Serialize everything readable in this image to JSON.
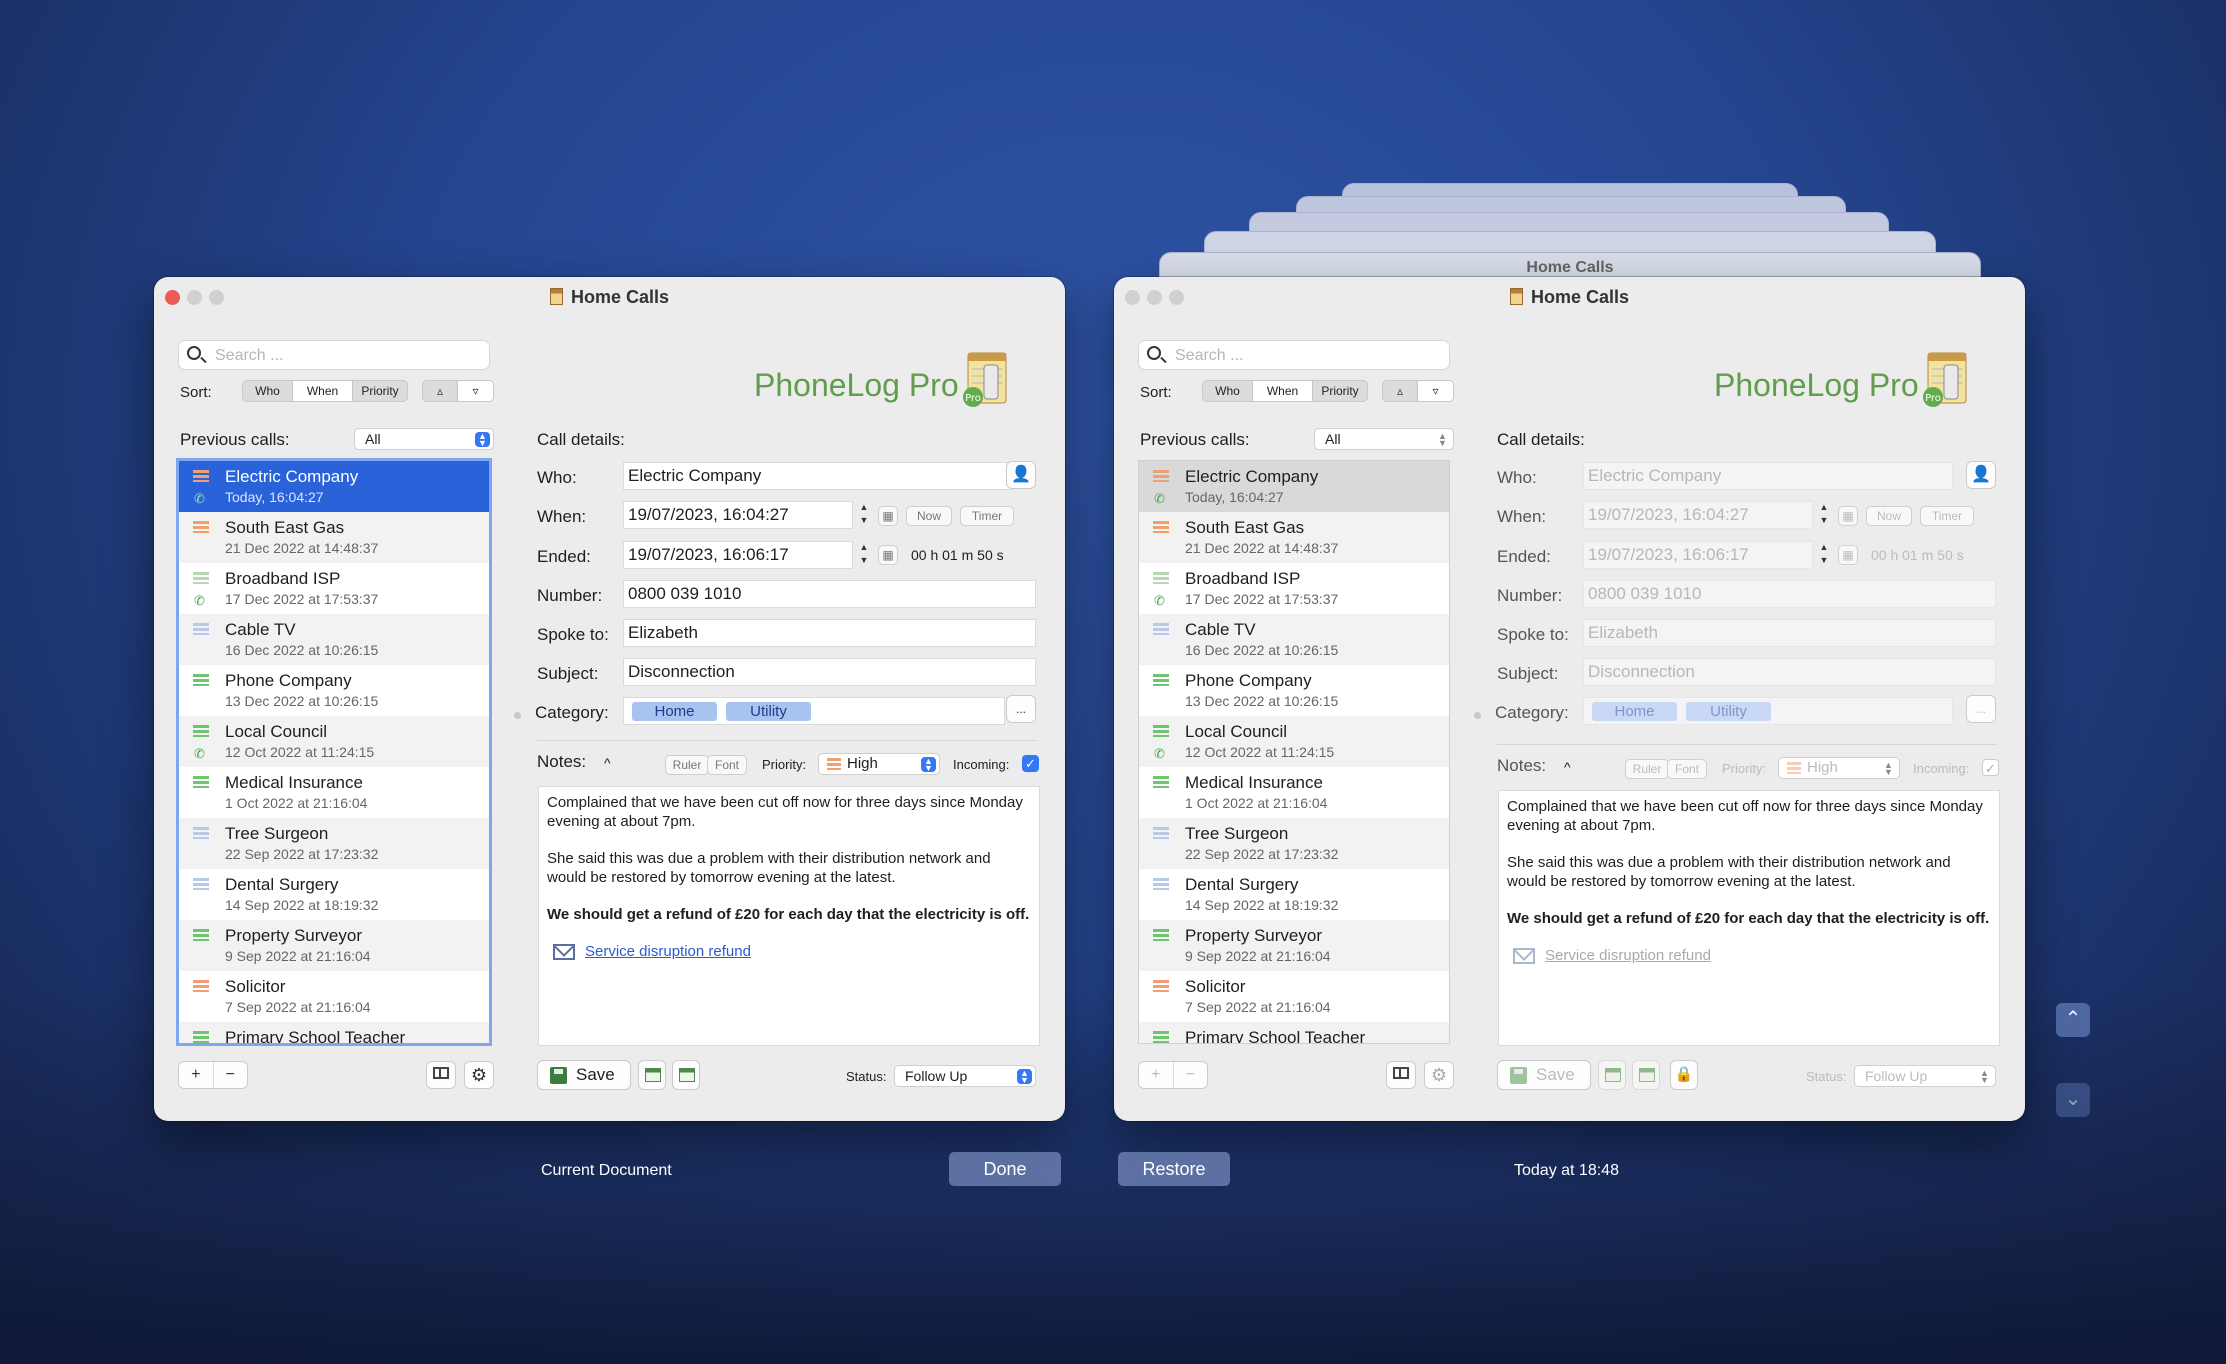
{
  "window_title": "Home Calls",
  "search_placeholder": "Search ...",
  "sort": {
    "label": "Sort:",
    "options": [
      "Who",
      "When",
      "Priority"
    ],
    "asc": "▵",
    "desc": "▿",
    "selected": "When"
  },
  "brand": "PhoneLog Pro",
  "previous_calls_label": "Previous calls:",
  "previous_calls_filter": "All",
  "call_details_label": "Call details:",
  "calls": [
    {
      "name": "Electric Company",
      "date": "Today, 16:04:27",
      "color": "#f0a070",
      "phone": true
    },
    {
      "name": "South East Gas",
      "date": "21 Dec 2022 at 14:48:37",
      "color": "#f0a070",
      "phone": false
    },
    {
      "name": "Broadband ISP",
      "date": "17 Dec 2022 at 17:53:37",
      "color": "#b8d8b0",
      "phone": true
    },
    {
      "name": "Cable TV",
      "date": "16 Dec 2022 at 10:26:15",
      "color": "#b8c8e8",
      "phone": false
    },
    {
      "name": "Phone Company",
      "date": "13 Dec 2022 at 10:26:15",
      "color": "#6fc46f",
      "phone": false
    },
    {
      "name": "Local Council",
      "date": "12 Oct 2022 at 11:24:15",
      "color": "#6fc46f",
      "phone": true
    },
    {
      "name": "Medical Insurance",
      "date": "1 Oct 2022 at 21:16:04",
      "color": "#6fc46f",
      "phone": false
    },
    {
      "name": "Tree Surgeon",
      "date": "22 Sep 2022 at 17:23:32",
      "color": "#b8c8e8",
      "phone": false
    },
    {
      "name": "Dental Surgery",
      "date": "14 Sep 2022 at 18:19:32",
      "color": "#b8c8e8",
      "phone": false
    },
    {
      "name": "Property Surveyor",
      "date": "9 Sep 2022 at 21:16:04",
      "color": "#6fc46f",
      "phone": false
    },
    {
      "name": "Solicitor",
      "date": "7 Sep 2022 at 21:16:04",
      "color": "#f0a070",
      "phone": false
    },
    {
      "name": "Primary School Teacher",
      "date": "",
      "color": "#6fc46f",
      "phone": false
    }
  ],
  "details": {
    "who_label": "Who:",
    "who": "Electric Company",
    "when_label": "When:",
    "when": "19/07/2023, 16:04:27",
    "now_btn": "Now",
    "timer_btn": "Timer",
    "ended_label": "Ended:",
    "ended": "19/07/2023, 16:06:17",
    "duration": "00 h  01 m  50 s",
    "number_label": "Number:",
    "number": "0800 039 1010",
    "spoke_label": "Spoke to:",
    "spoke": "Elizabeth",
    "subject_label": "Subject:",
    "subject": "Disconnection",
    "category_label": "Category:",
    "categories": [
      "Home",
      "Utility"
    ],
    "more_btn": "...",
    "notes_label": "Notes:",
    "notes_toggle": "^",
    "ruler_btn": "Ruler",
    "font_btn": "Font",
    "priority_label": "Priority:",
    "priority": "High",
    "incoming_label": "Incoming:",
    "notes_p1": "Complained that we have been cut off now for three days since Monday evening at about 7pm.",
    "notes_p2": "She said this was due a problem with their distribution network and would be restored by tomorrow evening at the latest.",
    "notes_p3": "We should get a refund of £20 for each day that the electricity is off.",
    "notes_link": "Service disruption refund",
    "save_btn": "Save",
    "status_label": "Status:",
    "status": "Follow Up"
  },
  "list_add": "+",
  "list_remove": "−",
  "bottom": {
    "current": "Current Document",
    "done": "Done",
    "restore": "Restore",
    "version_time": "Today at 18:48"
  },
  "arrows": {
    "up": "⌃",
    "down": "⌄"
  },
  "colors": {
    "accent": "#2a62d9",
    "brand": "#5f9e4e"
  }
}
